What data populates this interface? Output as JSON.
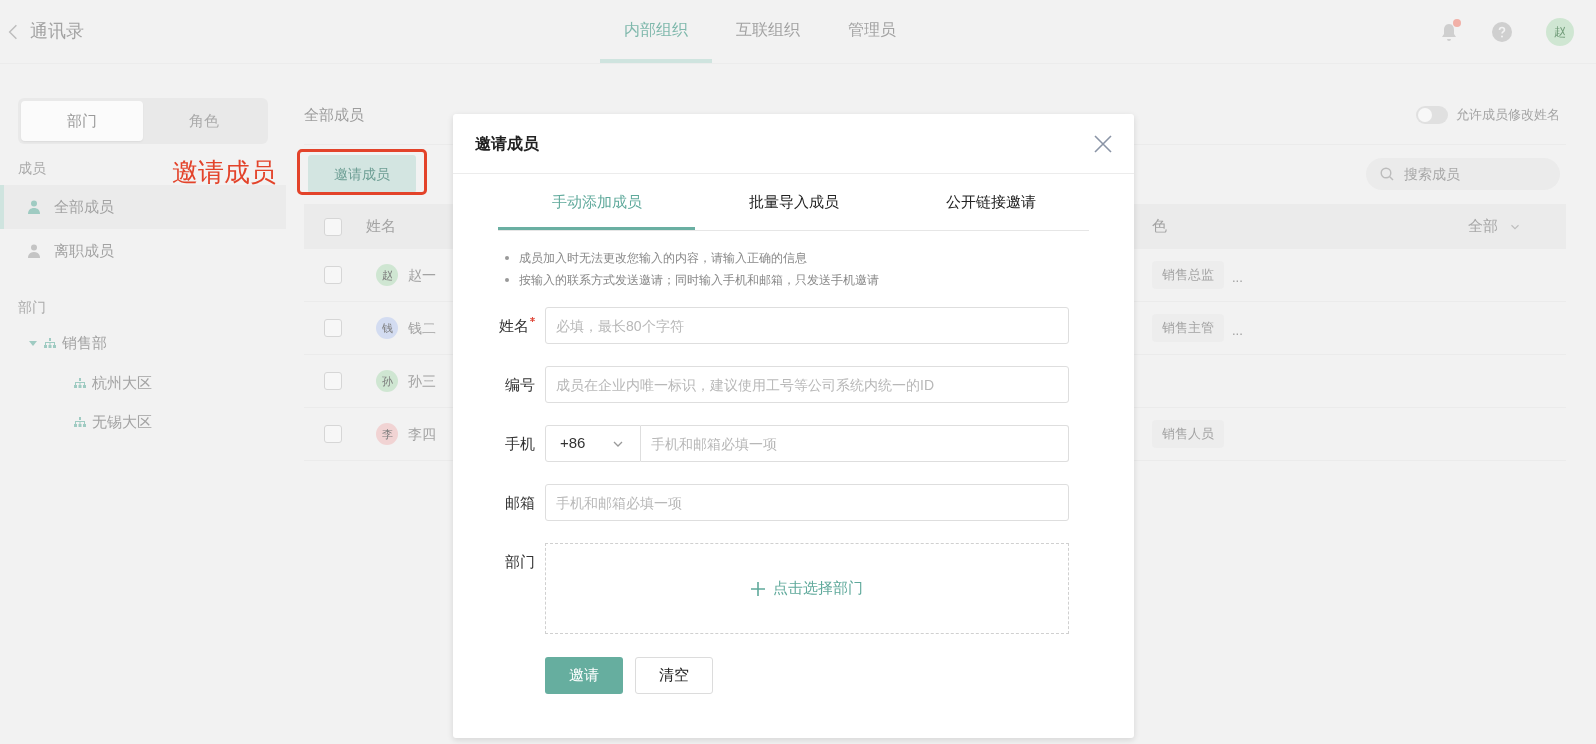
{
  "top_bar": {
    "back_label": "通讯录",
    "tabs": [
      {
        "label": "内部组织",
        "selected": true
      },
      {
        "label": "互联组织",
        "selected": false
      },
      {
        "label": "管理员",
        "selected": false
      }
    ],
    "unread": true,
    "avatar": "赵"
  },
  "sidebar": {
    "segments": [
      {
        "label": "部门",
        "selected": true
      },
      {
        "label": "角色",
        "selected": false
      }
    ],
    "members_heading": "成员",
    "member_items": [
      {
        "label": "全部成员",
        "selected": true
      },
      {
        "label": "离职成员",
        "selected": false
      }
    ],
    "departments_heading": "部门",
    "departments": [
      {
        "label": "销售部",
        "expanded": true,
        "children": [
          {
            "label": "杭州大区"
          },
          {
            "label": "无锡大区"
          }
        ]
      }
    ]
  },
  "main": {
    "title": "全部成员",
    "allow_rename": {
      "label": "允许成员修改姓名",
      "on": false
    },
    "invite_button": "邀请成员",
    "search": {
      "placeholder": "搜索成员"
    },
    "table": {
      "header_checked": false,
      "name_column": "姓名",
      "role_column": "色",
      "role_filter": "全部",
      "rows": [
        {
          "checked": false,
          "avatar": "赵",
          "color": "#cfe6d2",
          "name": "赵一",
          "role": "销售总监",
          "more": "..."
        },
        {
          "checked": false,
          "avatar": "钱",
          "color": "#d3dcf1",
          "name": "钱二",
          "role": "销售主管",
          "more": "..."
        },
        {
          "checked": false,
          "avatar": "孙",
          "color": "#cfe6d2",
          "name": "孙三"
        },
        {
          "checked": false,
          "avatar": "李",
          "color": "#f1d3d3",
          "name": "李四",
          "role": "销售人员"
        }
      ]
    }
  },
  "annotation": {
    "label": "邀请成员"
  },
  "dialog": {
    "title": "邀请成员",
    "tabs": [
      {
        "label": "手动添加成员",
        "selected": true
      },
      {
        "label": "批量导入成员",
        "selected": false
      },
      {
        "label": "公开链接邀请",
        "selected": false
      }
    ],
    "notes": [
      "成员加入时无法更改您输入的内容，请输入正确的信息",
      "按输入的联系方式发送邀请；同时输入手机和邮箱，只发送手机邀请"
    ],
    "fields": [
      {
        "kind": "text",
        "label": "姓名",
        "required": true,
        "placeholder": "必填，最长80个字符"
      },
      {
        "kind": "text",
        "label": "编号",
        "required": false,
        "placeholder": "成员在企业内唯一标识，建议使用工号等公司系统内统一的ID"
      },
      {
        "kind": "phone",
        "label": "手机",
        "required": false,
        "code": "+86",
        "placeholder": "手机和邮箱必填一项"
      },
      {
        "kind": "text",
        "label": "邮箱",
        "required": false,
        "placeholder": "手机和邮箱必填一项"
      },
      {
        "kind": "picker",
        "label": "部门",
        "required": false,
        "action": "点击选择部门"
      }
    ],
    "buttons": [
      {
        "kind": "primary",
        "label": "邀请"
      },
      {
        "kind": "secondary",
        "label": "清空"
      }
    ]
  }
}
